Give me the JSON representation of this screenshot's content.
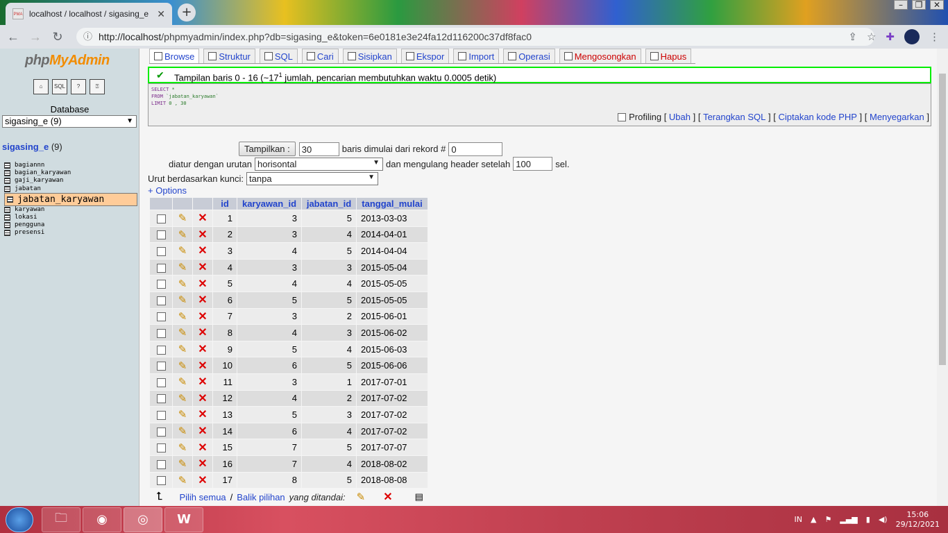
{
  "browser": {
    "tab_title": "localhost / localhost / sigasing_e",
    "favicon_text": "PMA",
    "url_scheme_host": "http://localhost",
    "url_path": "/phpmyadmin/index.php?db=sigasing_e&token=6e0181e3e24fa12d116200c37df8fac0"
  },
  "sidebar": {
    "logo_php": "php",
    "logo_myadmin": "MyAdmin",
    "database_label": "Database",
    "database_selected": "sigasing_e (9)",
    "db_name": "sigasing_e",
    "db_count": "(9)",
    "tables": [
      "bagiannn",
      "bagian_karyawan",
      "gaji_karyawan",
      "jabatan",
      "jabatan_karyawan",
      "karyawan",
      "lokasi",
      "pengguna",
      "presensi"
    ],
    "selected_table": "jabatan_karyawan"
  },
  "tabs": [
    {
      "label": "Browse",
      "icon": "browse-icon"
    },
    {
      "label": "Struktur",
      "icon": "structure-icon"
    },
    {
      "label": "SQL",
      "icon": "sql-icon"
    },
    {
      "label": "Cari",
      "icon": "search-icon"
    },
    {
      "label": "Sisipkan",
      "icon": "insert-icon"
    },
    {
      "label": "Ekspor",
      "icon": "export-icon"
    },
    {
      "label": "Import",
      "icon": "import-icon"
    },
    {
      "label": "Operasi",
      "icon": "operations-icon"
    },
    {
      "label": "Mengosongkan",
      "icon": "empty-icon"
    },
    {
      "label": "Hapus",
      "icon": "drop-icon"
    }
  ],
  "notice": {
    "text_before": "Tampilan baris 0 - 16 (~17",
    "sup": "1",
    "text_after": " jumlah, pencarian membutuhkan waktu 0.0005 detik)"
  },
  "sql": {
    "line1_kw": "SELECT",
    "line1_rest": " *",
    "line2_kw": "FROM",
    "line2_rest": " `jabatan_karyawan`",
    "line3_kw": "LIMIT",
    "line3_rest": " 0 , 30"
  },
  "sql_links": {
    "profiling": "Profiling",
    "ubah": "Ubah",
    "terangkan": "Terangkan SQL",
    "ciptakan": "Ciptakan kode PHP",
    "segarkan": "Menyegarkan"
  },
  "form": {
    "show_button": "Tampilkan :",
    "rows_value": "30",
    "rows_text": "baris dimulai dari rekord #",
    "start_value": "0",
    "order_label": "diatur dengan urutan",
    "order_selected": "horisontal",
    "repeat_text": "dan mengulang header setelah",
    "repeat_value": "100",
    "repeat_unit": "sel.",
    "sort_label": "Urut berdasarkan kunci:",
    "sort_selected": "tanpa",
    "options_link": "+ Options"
  },
  "table": {
    "headers": [
      "id",
      "karyawan_id",
      "jabatan_id",
      "tanggal_mulai"
    ],
    "rows": [
      [
        "1",
        "3",
        "5",
        "2013-03-03"
      ],
      [
        "2",
        "3",
        "4",
        "2014-04-01"
      ],
      [
        "3",
        "4",
        "5",
        "2014-04-04"
      ],
      [
        "4",
        "3",
        "3",
        "2015-05-04"
      ],
      [
        "5",
        "4",
        "4",
        "2015-05-05"
      ],
      [
        "6",
        "5",
        "5",
        "2015-05-05"
      ],
      [
        "7",
        "3",
        "2",
        "2015-06-01"
      ],
      [
        "8",
        "4",
        "3",
        "2015-06-02"
      ],
      [
        "9",
        "5",
        "4",
        "2015-06-03"
      ],
      [
        "10",
        "6",
        "5",
        "2015-06-06"
      ],
      [
        "11",
        "3",
        "1",
        "2017-07-01"
      ],
      [
        "12",
        "4",
        "2",
        "2017-07-02"
      ],
      [
        "13",
        "5",
        "3",
        "2017-07-02"
      ],
      [
        "14",
        "6",
        "4",
        "2017-07-02"
      ],
      [
        "15",
        "7",
        "5",
        "2017-07-07"
      ],
      [
        "16",
        "7",
        "4",
        "2018-08-02"
      ],
      [
        "17",
        "8",
        "5",
        "2018-08-08"
      ]
    ]
  },
  "footer": {
    "select_all": "Pilih semua",
    "separator": " / ",
    "invert": "Balik pilihan",
    "selected_text": "yang ditandai:"
  },
  "taskbar": {
    "lang": "IN",
    "time": "15:06",
    "date": "29/12/2021"
  }
}
